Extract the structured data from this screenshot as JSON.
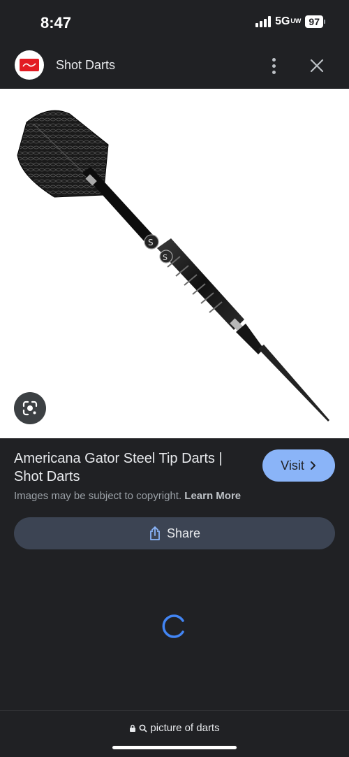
{
  "status_bar": {
    "time": "8:47",
    "network": "5G",
    "network_sub": "UW",
    "battery": "97"
  },
  "header": {
    "site_name": "Shot Darts",
    "logo_icon": "shot-darts-logo",
    "more_icon": "more-vert-icon",
    "close_icon": "close-icon"
  },
  "image": {
    "subject": "dart-product-image",
    "lens_icon": "google-lens-icon"
  },
  "result": {
    "title": "Americana Gator Steel Tip Darts | Shot Darts",
    "visit_label": "Visit",
    "copyright_text": "Images may be subject to copyright.",
    "learn_more_label": "Learn More",
    "share_label": "Share"
  },
  "bottom_bar": {
    "url_text": "picture of darts"
  },
  "colors": {
    "background": "#202124",
    "accent": "#8ab4f8",
    "share_bg": "#3c4453",
    "spinner": "#4285f4",
    "logo_red": "#e31b23"
  }
}
